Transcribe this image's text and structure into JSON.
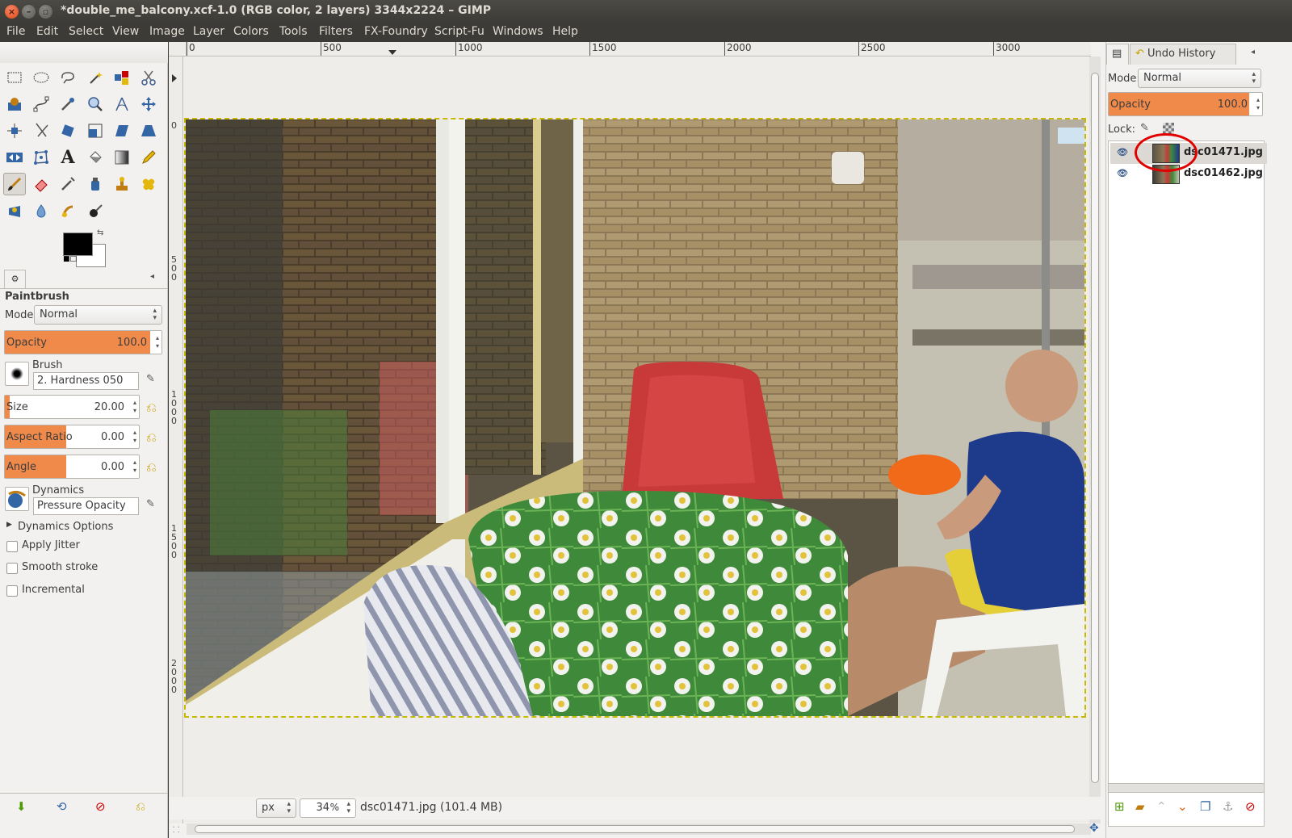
{
  "window": {
    "title": "*double_me_balcony.xcf-1.0 (RGB color, 2 layers) 3344x2224 – GIMP"
  },
  "menu": [
    "File",
    "Edit",
    "Select",
    "View",
    "Image",
    "Layer",
    "Colors",
    "Tools",
    "Filters",
    "FX-Foundry",
    "Script-Fu",
    "Windows",
    "Help"
  ],
  "tool_options": {
    "title": "Paintbrush",
    "mode_label": "Mode:",
    "mode_value": "Normal",
    "opacity_label": "Opacity",
    "opacity_value": "100.0",
    "brush_label": "Brush",
    "brush_value": "2. Hardness 050",
    "size_label": "Size",
    "size_value": "20.00",
    "aspect_label": "Aspect Ratio",
    "aspect_value": "0.00",
    "angle_label": "Angle",
    "angle_value": "0.00",
    "dynamics_label": "Dynamics",
    "dynamics_value": "Pressure Opacity",
    "dynamics_options": "Dynamics Options",
    "apply_jitter": "Apply Jitter",
    "smooth_stroke": "Smooth stroke",
    "incremental": "Incremental"
  },
  "rulers": {
    "h_ticks": [
      "0",
      "500",
      "1000",
      "1500",
      "2000",
      "2500",
      "3000"
    ],
    "v_ticks": [
      "0",
      "500",
      "1000",
      "1500",
      "2000"
    ]
  },
  "status": {
    "unit": "px",
    "zoom": "34",
    "zoom_unit": "%",
    "info": "dsc01471.jpg (101.4 MB)"
  },
  "layers": {
    "tab_label": "Undo History",
    "mode_label": "Mode:",
    "mode_value": "Normal",
    "opacity_label": "Opacity",
    "opacity_value": "100.0",
    "lock_label": "Lock:",
    "items": [
      {
        "name": "dsc01471.jpg",
        "visible": true
      },
      {
        "name": "dsc01462.jpg",
        "visible": true
      }
    ]
  },
  "colors": {
    "accent": "#f08a4b",
    "fg": "#000000",
    "bg": "#ffffff"
  }
}
